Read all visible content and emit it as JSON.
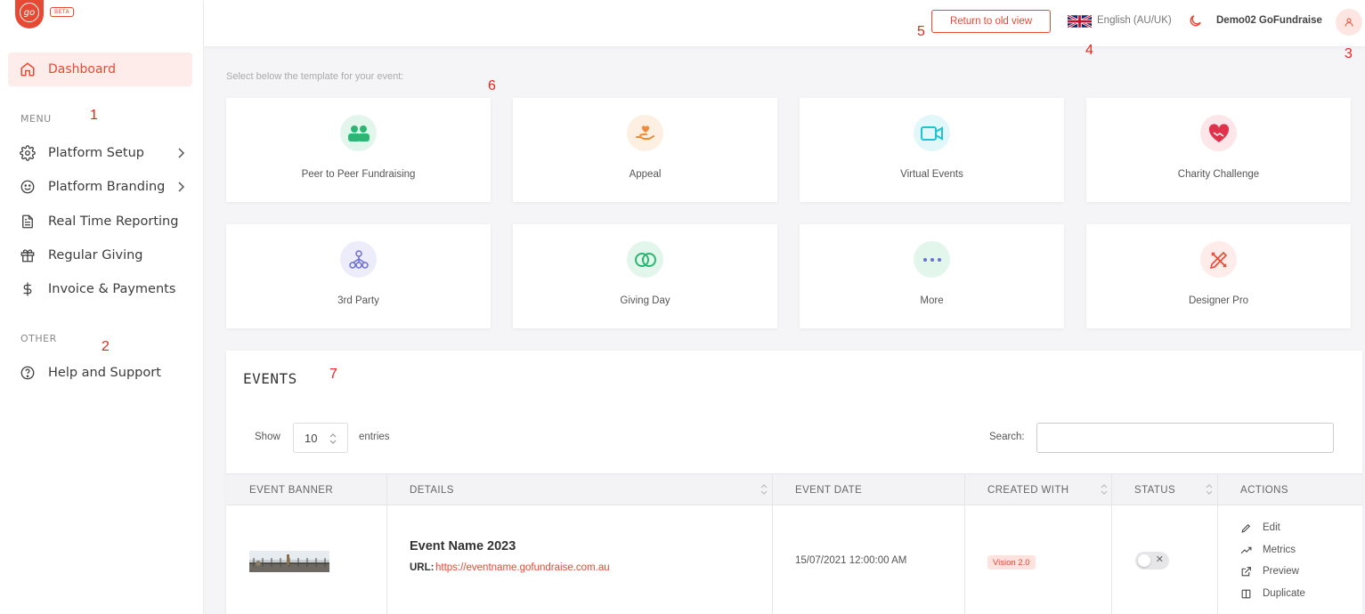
{
  "brand": {
    "logo_text": "go",
    "badge": "BETA"
  },
  "sidebar": {
    "dashboard": "Dashboard",
    "menu_label": "MENU",
    "menu_items": [
      {
        "label": "Platform Setup",
        "icon": "gear-icon",
        "has_chevron": true
      },
      {
        "label": "Platform Branding",
        "icon": "smile-icon",
        "has_chevron": true
      },
      {
        "label": "Real Time Reporting",
        "icon": "document-icon",
        "has_chevron": false
      },
      {
        "label": "Regular Giving",
        "icon": "gift-icon",
        "has_chevron": false
      },
      {
        "label": "Invoice & Payments",
        "icon": "dollar-icon",
        "has_chevron": false
      }
    ],
    "other_label": "OTHER",
    "other_items": [
      {
        "label": "Help and Support",
        "icon": "help-circle-icon"
      }
    ]
  },
  "topbar": {
    "return_button": "Return to old view",
    "language": "English (AU/UK)",
    "username": "Demo02 GoFundraise"
  },
  "annotations": [
    "1",
    "2",
    "3",
    "4",
    "5",
    "6",
    "7"
  ],
  "templates": {
    "helper": "Select below the template for your event:",
    "cards": [
      {
        "label": "Peer to Peer Fundraising",
        "icon": "people-icon",
        "color": "#2bb673",
        "bg": "#e3f6ec"
      },
      {
        "label": "Appeal",
        "icon": "heart-hand-icon",
        "color": "#f58b2e",
        "bg": "#fdf0e3"
      },
      {
        "label": "Virtual Events",
        "icon": "video-camera-icon",
        "color": "#1fc3d6",
        "bg": "#e2f7f9"
      },
      {
        "label": "Charity Challenge",
        "icon": "handshake-heart-icon",
        "color": "#e0324b",
        "bg": "#fde6e9"
      },
      {
        "label": "3rd Party",
        "icon": "network-icon",
        "color": "#6b6fd6",
        "bg": "#ececfa"
      },
      {
        "label": "Giving Day",
        "icon": "coins-icon",
        "color": "#2bb673",
        "bg": "#e3f6ec"
      },
      {
        "label": "More",
        "icon": "more-dots-icon",
        "color": "#6b6fd6",
        "bg": "#e3f6ec"
      },
      {
        "label": "Designer Pro",
        "icon": "design-tools-icon",
        "color": "#e64a34",
        "bg": "#fdece9"
      }
    ]
  },
  "events": {
    "title": "EVENTS",
    "show_label": "Show",
    "show_value": "10",
    "entries_label": "entries",
    "search_label": "Search:",
    "columns": [
      "EVENT BANNER",
      "DETAILS",
      "EVENT DATE",
      "CREATED WITH",
      "STATUS",
      "ACTIONS"
    ],
    "rows": [
      {
        "name": "Event Name 2023",
        "url_label": "URL:",
        "url": "https://eventname.gofundraise.com.au",
        "date": "15/07/2021 12:00:00 AM",
        "created_with": "Vision 2.0",
        "status": "off",
        "actions": [
          "Edit",
          "Metrics",
          "Preview",
          "Duplicate"
        ]
      }
    ]
  },
  "colors": {
    "accent": "#e64a34",
    "annotation": "#e8261c"
  }
}
